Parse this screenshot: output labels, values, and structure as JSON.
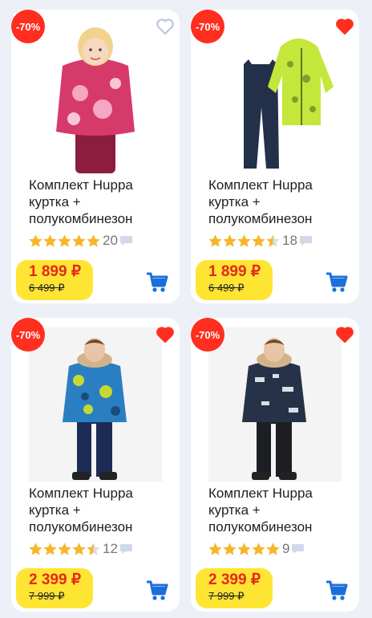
{
  "products": [
    {
      "discount": "-70%",
      "title": "Комплект Huppa куртка + полукомбинезон",
      "rating": 5,
      "reviews": "20",
      "price": "1 899 ₽",
      "old_price": "6 499 ₽",
      "favorite": false,
      "image": "pink winter set girl"
    },
    {
      "discount": "-70%",
      "title": "Комплект Huppa куртка + полукомбинезон",
      "rating": 4.5,
      "reviews": "18",
      "price": "1 899 ₽",
      "old_price": "6 499 ₽",
      "favorite": true,
      "image": "lime jacket navy overalls"
    },
    {
      "discount": "-70%",
      "title": "Комплект Huppa куртка + полукомбинезон",
      "rating": 4.5,
      "reviews": "12",
      "price": "2 399 ₽",
      "old_price": "7 999 ₽",
      "favorite": true,
      "image": "blue camo jacket boy"
    },
    {
      "discount": "-70%",
      "title": "Комплект Huppa куртка + полукомбинезон",
      "rating": 5,
      "reviews": "9",
      "price": "2 399 ₽",
      "old_price": "7 999 ₽",
      "favorite": true,
      "image": "navy print jacket boy"
    }
  ],
  "colors": {
    "badge": "#ff2e1f",
    "price_bg": "#ffe533",
    "price_text": "#e5271b",
    "star": "#f6b52a",
    "cart": "#1b6fdc",
    "favorite_on": "#ff2e1f",
    "favorite_off": "#b8c8df"
  },
  "icons": {
    "favorite": "heart-icon",
    "cart": "cart-icon",
    "reviews": "comment-bubble-icon",
    "rating": "star-icon"
  }
}
